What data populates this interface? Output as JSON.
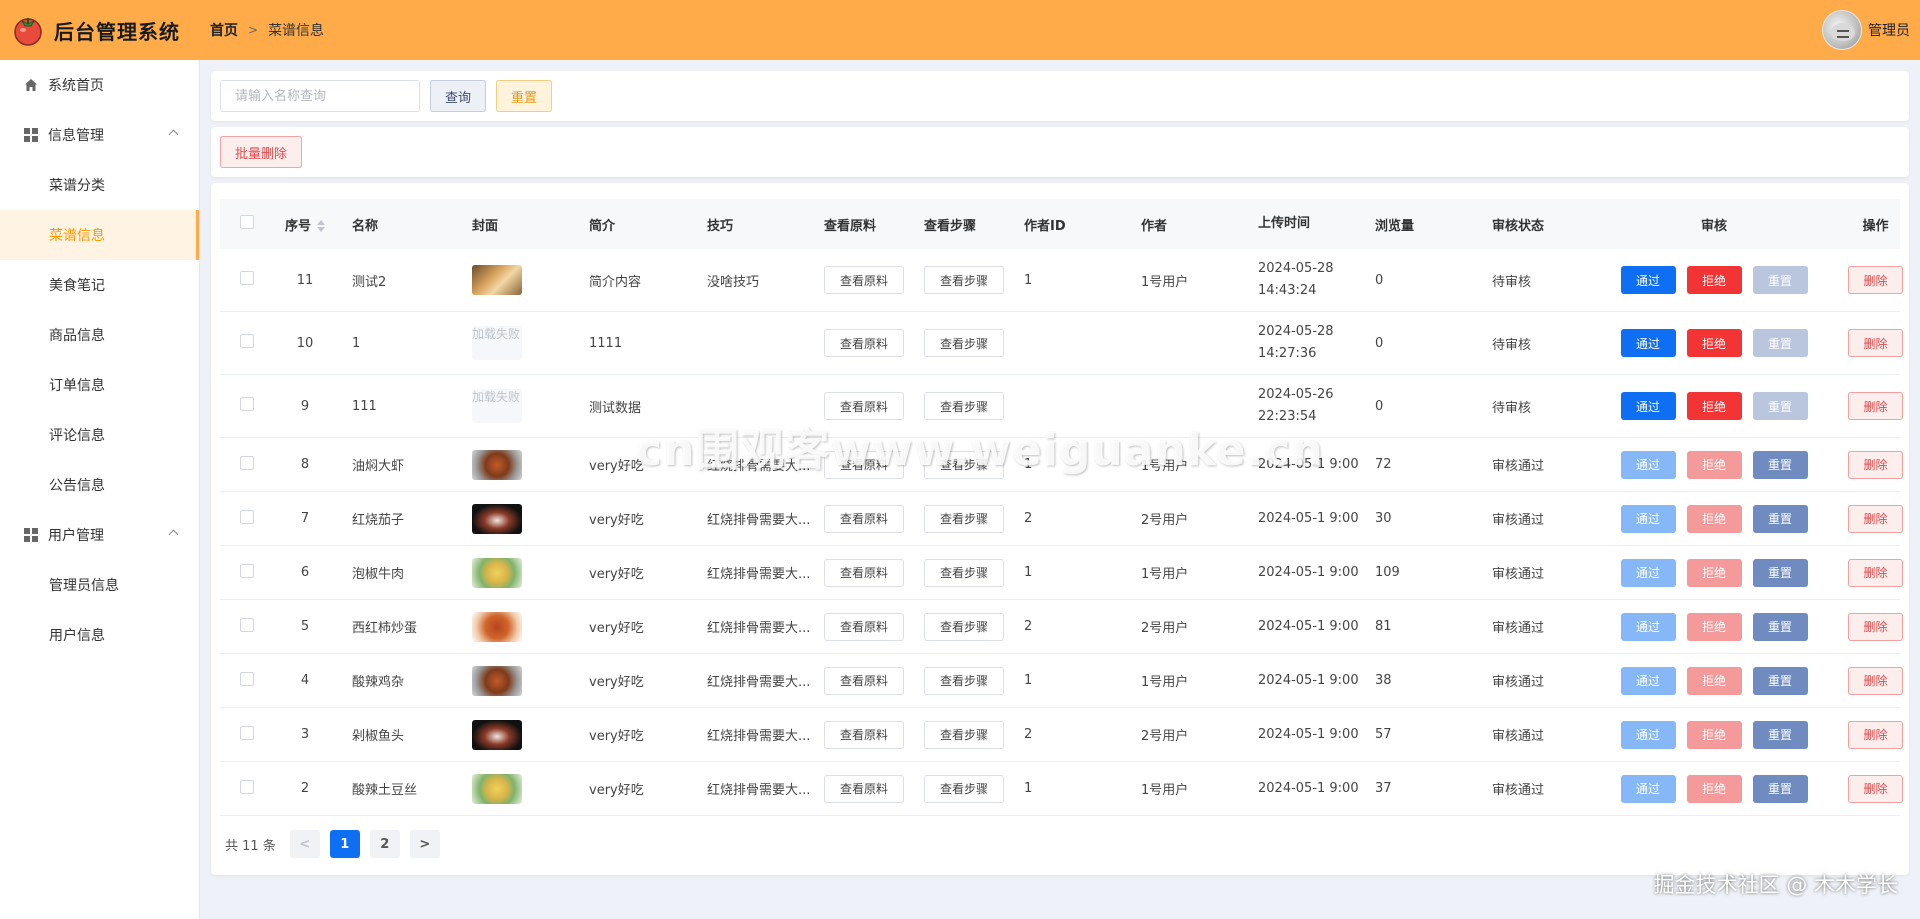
{
  "app": {
    "title": "后台管理系统",
    "user_name": "管理员",
    "colors": {
      "header": "#ffab4a",
      "primary": "#0e6ff5",
      "danger": "#f23434",
      "accent": "#ff9800"
    }
  },
  "breadcrumb": {
    "home": "首页",
    "separator": ">",
    "current": "菜谱信息"
  },
  "sidebar": {
    "items": [
      {
        "label": "系统首页",
        "icon": "home-icon"
      },
      {
        "label": "信息管理",
        "icon": "grid-icon",
        "expanded": true
      },
      {
        "label": "菜谱分类"
      },
      {
        "label": "菜谱信息",
        "active": true
      },
      {
        "label": "美食笔记"
      },
      {
        "label": "商品信息"
      },
      {
        "label": "订单信息"
      },
      {
        "label": "评论信息"
      },
      {
        "label": "公告信息"
      },
      {
        "label": "用户管理",
        "icon": "grid-icon",
        "expanded": true
      },
      {
        "label": "管理员信息"
      },
      {
        "label": "用户信息"
      }
    ]
  },
  "search": {
    "placeholder": "请输入名称查询",
    "value": "",
    "query_label": "查询",
    "reset_label": "重置"
  },
  "actions": {
    "batch_delete_label": "批量删除"
  },
  "table": {
    "headers": {
      "seq": "序号",
      "name": "名称",
      "cover": "封面",
      "desc": "简介",
      "tip": "技巧",
      "ingredients": "查看原料",
      "steps": "查看步骤",
      "author_id": "作者ID",
      "author": "作者",
      "upload_time": "上传时间",
      "views": "浏览量",
      "status": "审核状态",
      "audit": "审核",
      "op": "操作"
    },
    "labels": {
      "view_ingredients": "查看原料",
      "view_steps": "查看步骤",
      "pass": "通过",
      "reject": "拒绝",
      "regrade": "重置",
      "delete": "删除",
      "load_failed": "加载失败"
    },
    "rows": [
      {
        "seq": "11",
        "name": "测试2",
        "cover": "cover-doge",
        "desc": "简介内容",
        "tip": "没啥技巧",
        "author_id": "1",
        "author": "1号用户",
        "upload_time": "2024-05-28 14:43:24",
        "views": "0",
        "status": "待审核"
      },
      {
        "seq": "10",
        "name": "1",
        "cover": "failed",
        "desc": "1111",
        "tip": "",
        "author_id": "",
        "author": "",
        "upload_time": "2024-05-28 14:27:36",
        "views": "0",
        "status": "待审核"
      },
      {
        "seq": "9",
        "name": "111",
        "cover": "failed",
        "desc": "测试数据",
        "tip": "",
        "author_id": "",
        "author": "",
        "upload_time": "2024-05-26 22:23:54",
        "views": "0",
        "status": "待审核"
      },
      {
        "seq": "8",
        "name": "油焖大虾",
        "cover": "cover-shrimp",
        "desc": "very好吃",
        "tip": "红烧排骨需要大...",
        "author_id": "1",
        "author": "1号用户",
        "upload_time": "2024-05-1 9:00",
        "views": "72",
        "status": "审核通过"
      },
      {
        "seq": "7",
        "name": "红烧茄子",
        "cover": "cover-eggplant",
        "desc": "very好吃",
        "tip": "红烧排骨需要大...",
        "author_id": "2",
        "author": "2号用户",
        "upload_time": "2024-05-1 9:00",
        "views": "30",
        "status": "审核通过"
      },
      {
        "seq": "6",
        "name": "泡椒牛肉",
        "cover": "cover-pepper",
        "desc": "very好吃",
        "tip": "红烧排骨需要大...",
        "author_id": "1",
        "author": "1号用户",
        "upload_time": "2024-05-1 9:00",
        "views": "109",
        "status": "审核通过"
      },
      {
        "seq": "5",
        "name": "西红柿炒蛋",
        "cover": "cover-tomato",
        "desc": "very好吃",
        "tip": "红烧排骨需要大...",
        "author_id": "2",
        "author": "2号用户",
        "upload_time": "2024-05-1 9:00",
        "views": "81",
        "status": "审核通过"
      },
      {
        "seq": "4",
        "name": "酸辣鸡杂",
        "cover": "cover-shrimp",
        "desc": "very好吃",
        "tip": "红烧排骨需要大...",
        "author_id": "1",
        "author": "1号用户",
        "upload_time": "2024-05-1 9:00",
        "views": "38",
        "status": "审核通过"
      },
      {
        "seq": "3",
        "name": "剁椒鱼头",
        "cover": "cover-eggplant",
        "desc": "very好吃",
        "tip": "红烧排骨需要大...",
        "author_id": "2",
        "author": "2号用户",
        "upload_time": "2024-05-1 9:00",
        "views": "57",
        "status": "审核通过"
      },
      {
        "seq": "2",
        "name": "酸辣土豆丝",
        "cover": "cover-pepper",
        "desc": "very好吃",
        "tip": "红烧排骨需要大...",
        "author_id": "1",
        "author": "1号用户",
        "upload_time": "2024-05-1 9:00",
        "views": "37",
        "status": "审核通过"
      }
    ]
  },
  "pagination": {
    "total": "共 11 条",
    "prev": "<",
    "next": ">",
    "pages": [
      "1",
      "2"
    ],
    "current": "1"
  },
  "watermarks": {
    "center": "cn围观客www.weiguanke.cn",
    "footer": "掘金技术社区 @ 木木学长"
  }
}
